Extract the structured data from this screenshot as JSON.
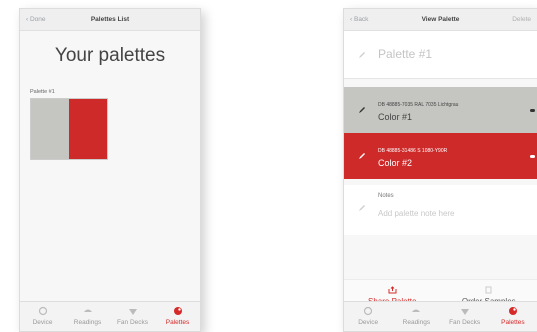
{
  "left": {
    "nav": {
      "back_label": "Done",
      "title": "Palettes List"
    },
    "heading": "Your palettes",
    "palette": {
      "label": "Palette #1",
      "swatches": [
        "#c5c6c1",
        "#cf2a2a"
      ]
    }
  },
  "right": {
    "nav": {
      "back_label": "Back",
      "title": "View Palette",
      "delete_label": "Delete"
    },
    "palette_name": "Palette #1",
    "colors": [
      {
        "code": "DB 48885-7035 RAL 7035 Lichtgrau",
        "name": "Color #1",
        "bg": "#c5c6c1"
      },
      {
        "code": "DB 48885-31486 S 1080-Y90R",
        "name": "Color #2",
        "bg": "#cf2a2a"
      }
    ],
    "notes": {
      "label": "Notes",
      "placeholder": "Add palette note here"
    },
    "actions": {
      "share": "Share Palette",
      "order": "Order Samples"
    }
  },
  "tabs": [
    {
      "label": "Device",
      "icon": "device-icon"
    },
    {
      "label": "Readings",
      "icon": "readings-icon"
    },
    {
      "label": "Fan Decks",
      "icon": "fan-decks-icon"
    },
    {
      "label": "Palettes",
      "icon": "palettes-icon",
      "active": true
    }
  ],
  "colors": {
    "accent": "#d62a2a",
    "gray_swatch": "#c5c6c1",
    "red_swatch": "#cf2a2a"
  }
}
